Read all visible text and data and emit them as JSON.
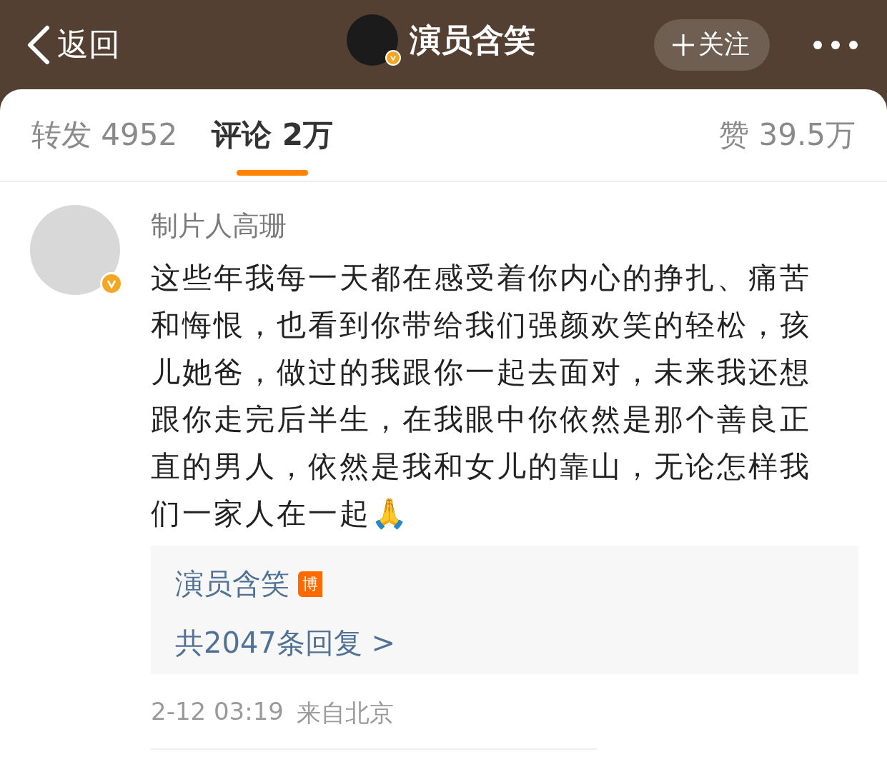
{
  "header": {
    "back_label": "返回",
    "account_name": "演员含笑",
    "follow_label": "关注"
  },
  "tabs": [
    {
      "label": "转发 4952",
      "selected": false
    },
    {
      "label": "评论 2万",
      "selected": true
    },
    {
      "label": "赞 39.5万",
      "selected": false
    }
  ],
  "comment": {
    "author": "制片人高珊",
    "verified": true,
    "text": "这些年我每一天都在感受着你内心的挣扎、痛苦和悔恨，也看到你带给我们强颜欢笑的轻松，孩儿她爸，做过的我跟你一起去面对，未来我还想跟你走完后半生，在我眼中你依然是那个善良正直的男人，依然是我和女儿的靠山，无论怎样我们一家人在一起🙏",
    "reply": {
      "author": "演员含笑",
      "badge": "博",
      "summary": "共2047条回复 >"
    },
    "time": "2-12 03:19",
    "source": "来自北京"
  }
}
